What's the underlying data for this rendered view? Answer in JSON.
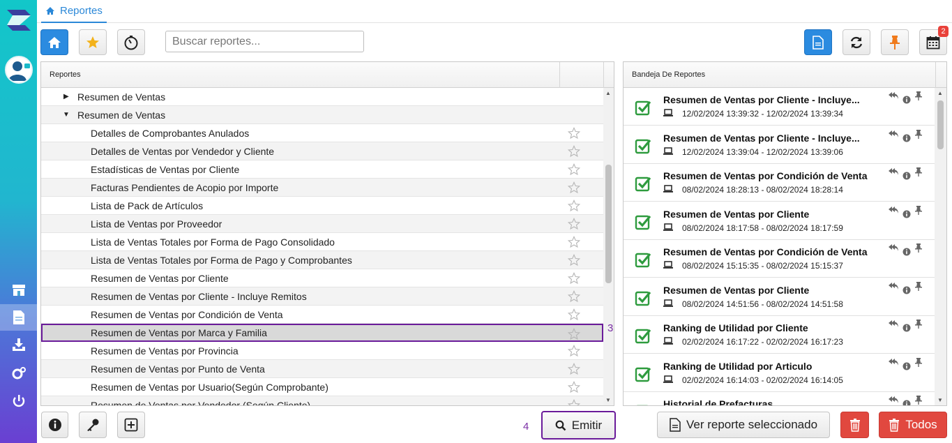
{
  "app": {
    "colors": {
      "accent": "#2b88d8",
      "danger": "#e1483f",
      "highlight": "#6a1b9a",
      "success": "#2e9b3e"
    }
  },
  "tab": {
    "label": "Reportes",
    "icon": "home-icon"
  },
  "toolbar": {
    "search_placeholder": "Buscar reportes...",
    "calendar_badge": "2"
  },
  "reports_panel": {
    "header": "Reportes",
    "groups": [
      {
        "label": "Resumen de Ventas",
        "expanded": false
      },
      {
        "label": "Resumen de Ventas",
        "expanded": true
      }
    ],
    "items": [
      "Detalles de Comprobantes Anulados",
      "Detalles de Ventas por Vendedor y Cliente",
      "Estadísticas de Ventas por Cliente",
      "Facturas Pendientes de Acopio por Importe",
      "Lista de Pack de Artículos",
      "Lista de Ventas por Proveedor",
      "Lista de Ventas Totales por Forma de Pago Consolidado",
      "Lista de Ventas Totales por Forma de Pago y Comprobantes",
      "Resumen de Ventas por Cliente",
      "Resumen de Ventas por Cliente - Incluye Remitos",
      "Resumen de Ventas por Condición de Venta",
      "Resumen de Ventas por Marca y Familia",
      "Resumen de Ventas por Provincia",
      "Resumen de Ventas por Punto de Venta",
      "Resumen de Ventas por Usuario(Según Comprobante)",
      "Resumen de Ventas por Vendedor (Según Cliente)"
    ],
    "selected_label": "Resumen de Ventas por Marca y Familia"
  },
  "tray_panel": {
    "header": "Bandeja De Reportes",
    "items": [
      {
        "title": "Resumen de Ventas por Cliente - Incluye...",
        "date": "12/02/2024 13:39:32 - 12/02/2024 13:39:34"
      },
      {
        "title": "Resumen de Ventas por Cliente - Incluye...",
        "date": "12/02/2024 13:39:04 - 12/02/2024 13:39:06"
      },
      {
        "title": "Resumen de Ventas por Condición de Venta",
        "date": "08/02/2024 18:28:13 - 08/02/2024 18:28:14"
      },
      {
        "title": "Resumen de Ventas por Cliente",
        "date": "08/02/2024 18:17:58 - 08/02/2024 18:17:59"
      },
      {
        "title": "Resumen de Ventas por Condición de Venta",
        "date": "08/02/2024 15:15:35 - 08/02/2024 15:15:37"
      },
      {
        "title": "Resumen de Ventas por Cliente",
        "date": "08/02/2024 14:51:56 - 08/02/2024 14:51:58"
      },
      {
        "title": "Ranking de Utilidad por Cliente",
        "date": "02/02/2024 16:17:22 - 02/02/2024 16:17:23"
      },
      {
        "title": "Ranking de Utilidad por Articulo",
        "date": "02/02/2024 16:14:03 - 02/02/2024 16:14:05"
      },
      {
        "title": "Historial de Prefacturas",
        "date": ""
      }
    ]
  },
  "bottom": {
    "emit_label": "Emitir",
    "view_selected_label": "Ver reporte seleccionado",
    "all_label": "Todos",
    "step_3": "3",
    "step_4": "4"
  }
}
